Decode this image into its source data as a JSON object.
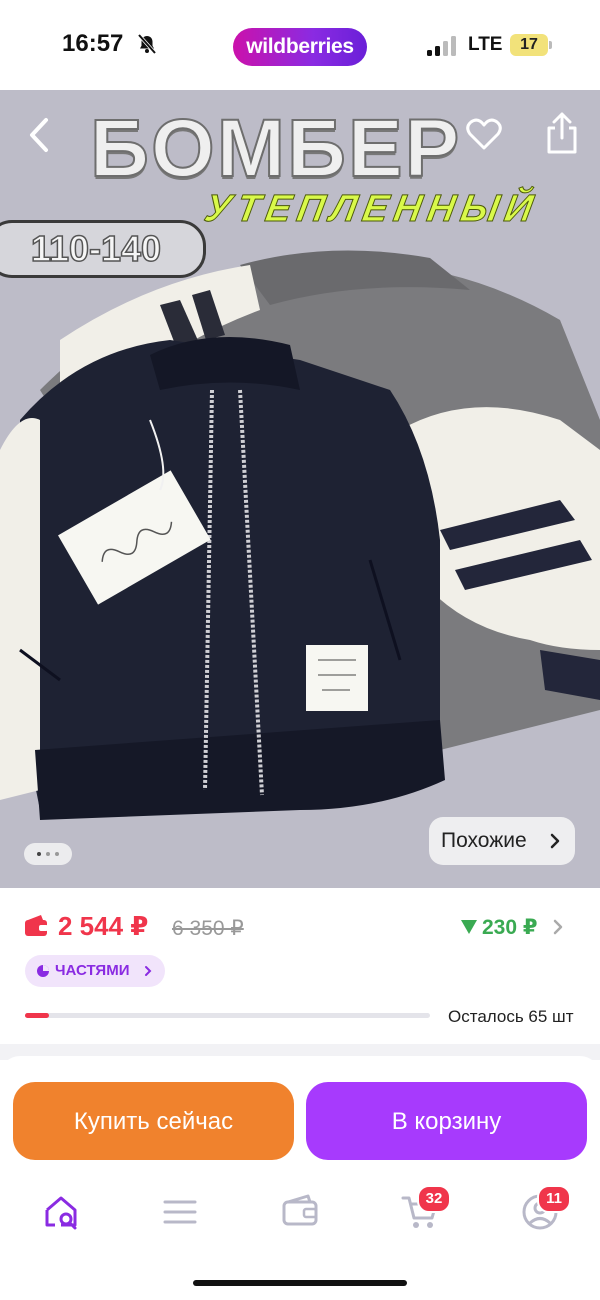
{
  "status_bar": {
    "time": "16:57",
    "brand": "wildberries",
    "network": "LTE",
    "battery": "17"
  },
  "hero": {
    "title": "БОМБЕР",
    "subtitle": "УТЕПЛЕННЫЙ",
    "size_range": "110-140",
    "similar_label": "Похожие",
    "image_count": 3,
    "current_image": 1
  },
  "price": {
    "current": "2 544 ₽",
    "old": "6 350 ₽",
    "cashback": "230 ₽",
    "installment_label": "ЧАСТЯМИ",
    "stock_text": "Осталось 65 шт",
    "stock_fill_fraction": 0.06
  },
  "actions": {
    "buy_now": "Купить сейчас",
    "add_to_cart": "В корзину"
  },
  "tabbar": {
    "cart_badge": "32",
    "profile_badge": "11"
  },
  "colors": {
    "brand_purple": "#a73afd",
    "buy_orange": "#f0822d",
    "price_red": "#f0354b",
    "cashback_green": "#3aaa52"
  }
}
